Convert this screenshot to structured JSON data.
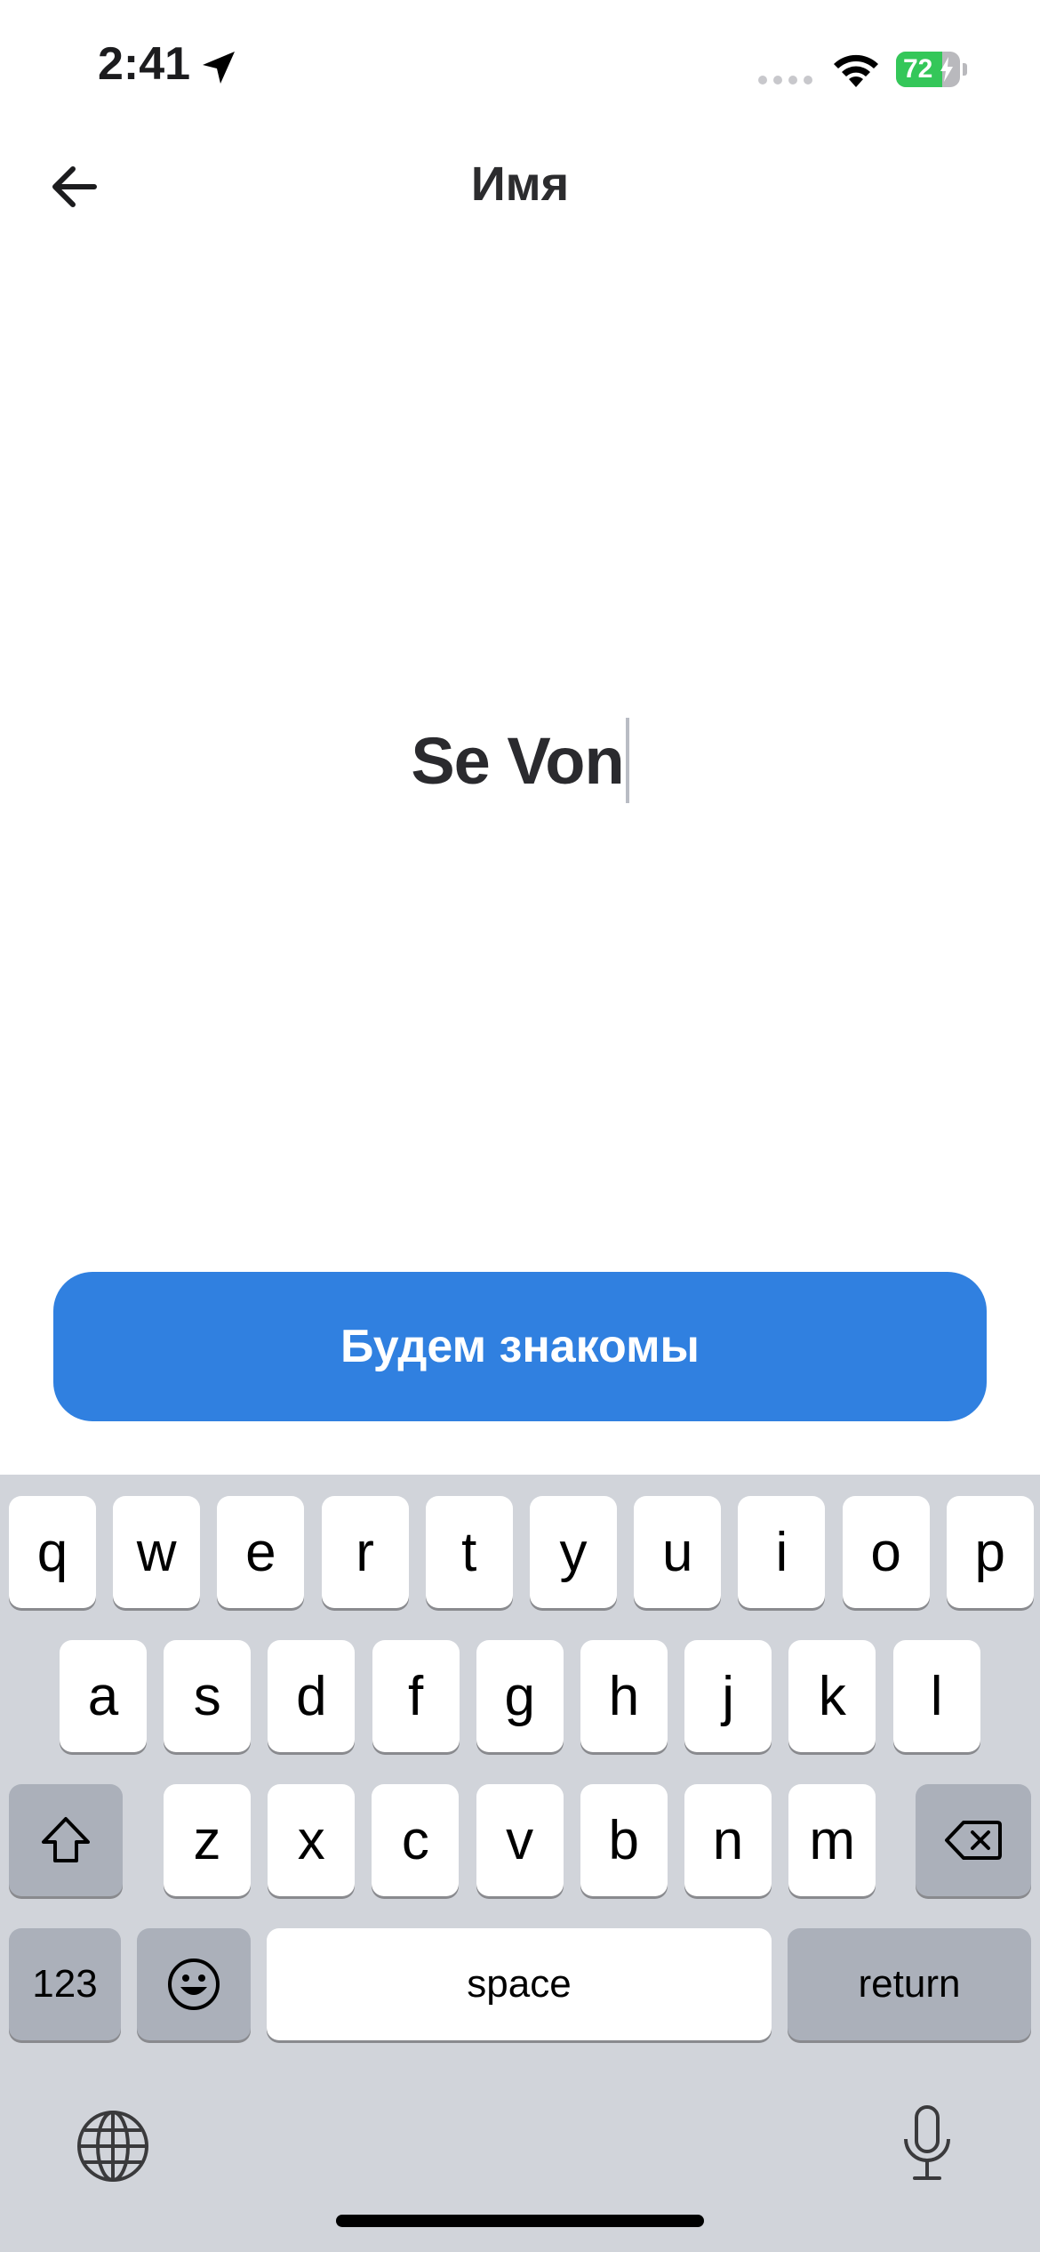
{
  "status_bar": {
    "time": "2:41",
    "battery_percent": "72",
    "battery_level": 0.72,
    "icons": [
      "location-arrow-icon",
      "signal-dots-icon",
      "wifi-icon",
      "battery-charging-icon"
    ]
  },
  "nav": {
    "title": "Имя",
    "back_icon": "arrow-left-icon"
  },
  "form": {
    "name_value": "Se Von",
    "submit_label": "Будем знакомы"
  },
  "colors": {
    "accent": "#3080e0",
    "battery_green": "#34c759",
    "keyboard_bg": "#d1d4da"
  },
  "keyboard": {
    "row1": [
      "q",
      "w",
      "e",
      "r",
      "t",
      "y",
      "u",
      "i",
      "o",
      "p"
    ],
    "row2": [
      "a",
      "s",
      "d",
      "f",
      "g",
      "h",
      "j",
      "k",
      "l"
    ],
    "row3": [
      "z",
      "x",
      "c",
      "v",
      "b",
      "n",
      "m"
    ],
    "numbers_label": "123",
    "space_label": "space",
    "return_label": "return",
    "icons": [
      "shift-icon",
      "delete-icon",
      "emoji-icon",
      "globe-icon",
      "microphone-icon"
    ]
  }
}
